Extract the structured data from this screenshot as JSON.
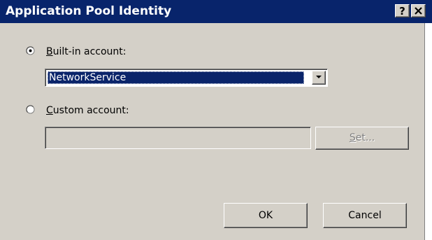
{
  "window": {
    "title": "Application Pool Identity",
    "help_glyph": "?",
    "colors": {
      "titlebar": "#08246b",
      "face": "#d4d0c8",
      "selection": "#0a246a"
    }
  },
  "builtin": {
    "label_accel": "B",
    "label_rest": "uilt-in account:",
    "selected": true,
    "value": "NetworkService"
  },
  "custom": {
    "label_accel": "C",
    "label_rest": "ustom account:",
    "selected": false,
    "value": ""
  },
  "buttons": {
    "set_accel": "S",
    "set_rest": "et...",
    "ok": "OK",
    "cancel": "Cancel"
  }
}
